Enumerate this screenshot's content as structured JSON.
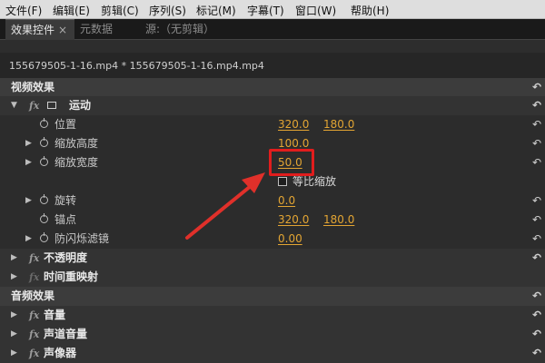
{
  "menu": [
    "文件(F)",
    "编辑(E)",
    "剪辑(C)",
    "序列(S)",
    "标记(M)",
    "字幕(T)",
    "窗口(W)",
    "帮助(H)"
  ],
  "tabs": {
    "effects": "效果控件",
    "close": "×",
    "metadata": "元数据",
    "source": "源:（无剪辑）"
  },
  "clip_name": "155679505-1-16.mp4 * 155679505-1-16.mp4.mp4",
  "video_effects": {
    "title": "视频效果",
    "fx": "fx",
    "motion": "运动",
    "position": {
      "label": "位置",
      "x": "320.0",
      "y": "180.0"
    },
    "scale_height": {
      "label": "缩放高度",
      "value": "100.0"
    },
    "scale_width": {
      "label": "缩放宽度",
      "value": "50.0"
    },
    "uniform_scale": "等比缩放",
    "rotation": {
      "label": "旋转",
      "value": "0.0"
    },
    "anchor": {
      "label": "锚点",
      "x": "320.0",
      "y": "180.0"
    },
    "anti_flicker": {
      "label": "防闪烁滤镜",
      "value": "0.00"
    },
    "opacity": "不透明度",
    "time_remap": "时间重映射"
  },
  "audio_effects": {
    "title": "音频效果",
    "volume": "音量",
    "channel_volume": "声道音量",
    "panner": "声像器"
  },
  "colors": {
    "value": "#e3a533",
    "highlight": "#e11d1d",
    "arrow": "#e0302a"
  }
}
